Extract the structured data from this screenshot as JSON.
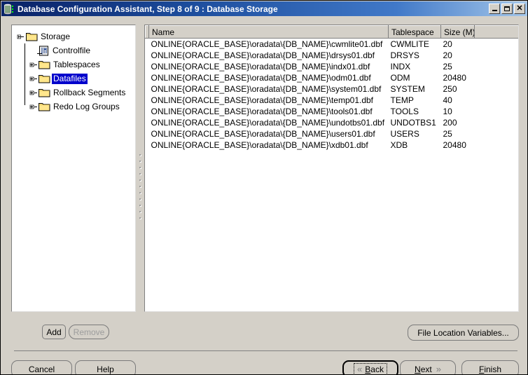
{
  "window": {
    "title": "Database Configuration Assistant, Step 8 of 9 : Database Storage",
    "icon": "database-icon",
    "minimize_label": "Minimize",
    "maximize_label": "Maximize",
    "close_label": "Close"
  },
  "tree": {
    "nodes": [
      {
        "label": "Storage",
        "icon": "folder-icon",
        "expanded": true,
        "selected": false,
        "level": 0
      },
      {
        "label": "Controlfile",
        "icon": "controlfile-icon",
        "expanded": null,
        "selected": false,
        "level": 1
      },
      {
        "label": "Tablespaces",
        "icon": "folder-icon",
        "expanded": false,
        "selected": false,
        "level": 1
      },
      {
        "label": "Datafiles",
        "icon": "folder-icon",
        "expanded": false,
        "selected": true,
        "level": 1
      },
      {
        "label": "Rollback Segments",
        "icon": "folder-icon",
        "expanded": false,
        "selected": false,
        "level": 1
      },
      {
        "label": "Redo Log Groups",
        "icon": "folder-icon",
        "expanded": false,
        "selected": false,
        "level": 1
      }
    ]
  },
  "table": {
    "columns": [
      "",
      "Name",
      "Tablespace",
      "Size (M)",
      ""
    ],
    "rows": [
      {
        "name": "ONLINE{ORACLE_BASE}\\oradata\\{DB_NAME}\\cwmlite01.dbf",
        "tablespace": "CWMLITE",
        "size": "20"
      },
      {
        "name": "ONLINE{ORACLE_BASE}\\oradata\\{DB_NAME}\\drsys01.dbf",
        "tablespace": "DRSYS",
        "size": "20"
      },
      {
        "name": "ONLINE{ORACLE_BASE}\\oradata\\{DB_NAME}\\indx01.dbf",
        "tablespace": "INDX",
        "size": "25"
      },
      {
        "name": "ONLINE{ORACLE_BASE}\\oradata\\{DB_NAME}\\odm01.dbf",
        "tablespace": "ODM",
        "size": "20480"
      },
      {
        "name": "ONLINE{ORACLE_BASE}\\oradata\\{DB_NAME}\\system01.dbf",
        "tablespace": "SYSTEM",
        "size": "250"
      },
      {
        "name": "ONLINE{ORACLE_BASE}\\oradata\\{DB_NAME}\\temp01.dbf",
        "tablespace": "TEMP",
        "size": "40"
      },
      {
        "name": "ONLINE{ORACLE_BASE}\\oradata\\{DB_NAME}\\tools01.dbf",
        "tablespace": "TOOLS",
        "size": "10"
      },
      {
        "name": "ONLINE{ORACLE_BASE}\\oradata\\{DB_NAME}\\undotbs01.dbf",
        "tablespace": "UNDOTBS1",
        "size": "200"
      },
      {
        "name": "ONLINE{ORACLE_BASE}\\oradata\\{DB_NAME}\\users01.dbf",
        "tablespace": "USERS",
        "size": "25"
      },
      {
        "name": "ONLINE{ORACLE_BASE}\\oradata\\{DB_NAME}\\xdb01.dbf",
        "tablespace": "XDB",
        "size": "20480"
      }
    ]
  },
  "actions": {
    "add": "Add",
    "remove": "Remove",
    "file_location_variables": "File Location Variables..."
  },
  "navigation": {
    "cancel": "Cancel",
    "help": "Help",
    "back": "Back",
    "back_mnemonic": "B",
    "back_arrow": "«",
    "next": "Next",
    "next_mnemonic": "N",
    "next_arrow": "»",
    "finish": "Finish",
    "finish_mnemonic": "F"
  },
  "colors": {
    "title_start": "#0a246a",
    "title_end": "#a6c8ea",
    "selection": "#0000cc",
    "face": "#d4d0c8",
    "folder": "#ffe68c"
  }
}
